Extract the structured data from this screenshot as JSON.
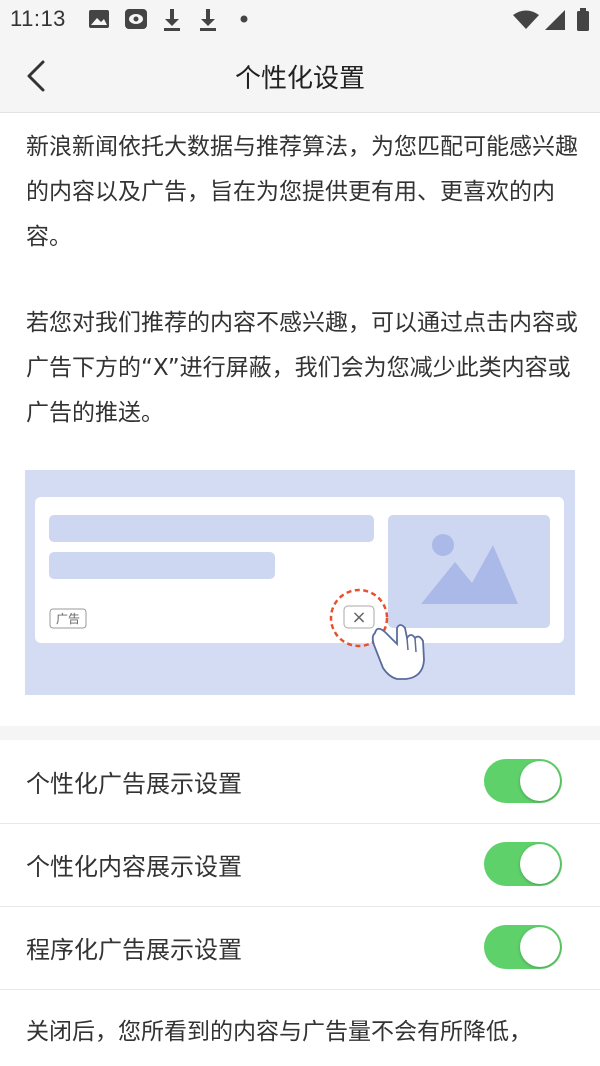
{
  "status_bar": {
    "time": "11:13",
    "left_icons": [
      "image-icon",
      "news-app-icon",
      "download-icon",
      "download-icon",
      "dot-icon"
    ],
    "right_icons": [
      "wifi-icon",
      "signal-icon",
      "battery-icon"
    ]
  },
  "header": {
    "back_icon": "chevron-left-icon",
    "title": "个性化设置"
  },
  "intro": {
    "paragraph1": " 新浪新闻依托大数据与推荐算法，为您匹配可能感兴趣的内容以及广告，旨在为您提供更有用、更喜欢的内容。",
    "paragraph2": "若您对我们推荐的内容不感兴趣，可以通过点击内容或广告下方的“X”进行屏蔽，我们会为您减少此类内容或广告的推送。"
  },
  "illustration": {
    "ad_tag": "广告",
    "close_symbol": "×",
    "colors": {
      "background": "#d4dcf3",
      "card": "#ffffff",
      "placeholder": "#cdd7f2",
      "dashed_circle": "#e8502e"
    }
  },
  "settings": [
    {
      "label": "个性化广告展示设置",
      "enabled": true
    },
    {
      "label": "个性化内容展示设置",
      "enabled": true
    },
    {
      "label": "程序化广告展示设置",
      "enabled": true
    }
  ],
  "footer": {
    "text": "关闭后，您所看到的内容与广告量不会有所降低，"
  },
  "colors": {
    "toggle_on": "#5fd16a",
    "header_bg": "#f5f5f5",
    "text": "#333333"
  }
}
